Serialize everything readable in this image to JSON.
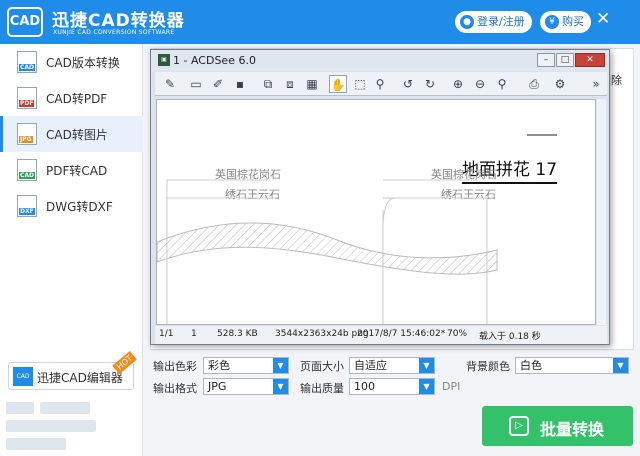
{
  "app": {
    "logo": "CAD",
    "title": "迅捷CAD转换器",
    "subtitle": "XUNJIE CAD CONVERSION SOFTWARE",
    "login": "登录/注册",
    "buy": "购买",
    "close": "✕"
  },
  "sidebar": {
    "items": [
      {
        "label": "CAD版本转换",
        "badge": "CAD"
      },
      {
        "label": "CAD转PDF",
        "badge": "PDF"
      },
      {
        "label": "CAD转图片",
        "badge": "JPG"
      },
      {
        "label": "PDF转CAD",
        "badge": "CAD"
      },
      {
        "label": "DWG转DXF",
        "badge": "DXF"
      }
    ],
    "editor": {
      "label": "迅捷CAD编辑器",
      "icon_text": "CAD",
      "hot": "HOT"
    }
  },
  "main": {
    "delete_label": "删除"
  },
  "options": {
    "color_label": "输出色彩",
    "color_value": "彩色",
    "page_label": "页面大小",
    "page_value": "自适应",
    "bg_label": "背景颜色",
    "bg_value": "白色",
    "format_label": "输出格式",
    "format_value": "JPG",
    "quality_label": "输出质量",
    "quality_value": "100",
    "dpi": "DPI"
  },
  "convert_button": "批量转换",
  "acdsee": {
    "title": "1 - ACDSee 6.0",
    "status": {
      "page": "1/1",
      "count": "1",
      "size": "528.3 KB",
      "dims": "3544x2363x24b png",
      "date": "2017/8/7 15:46:02*",
      "zoom": "70%",
      "load": "载入于 0.18 秒"
    },
    "drawing": {
      "title": "地面拼花 17",
      "left_l1": "英国棕花岗石",
      "left_l2": "绣石王云石",
      "right_l1": "英国棕花岗石",
      "right_l2": "绣石王云石"
    }
  },
  "colors": {
    "accent": "#1e8ce8",
    "convert": "#33c26a"
  }
}
